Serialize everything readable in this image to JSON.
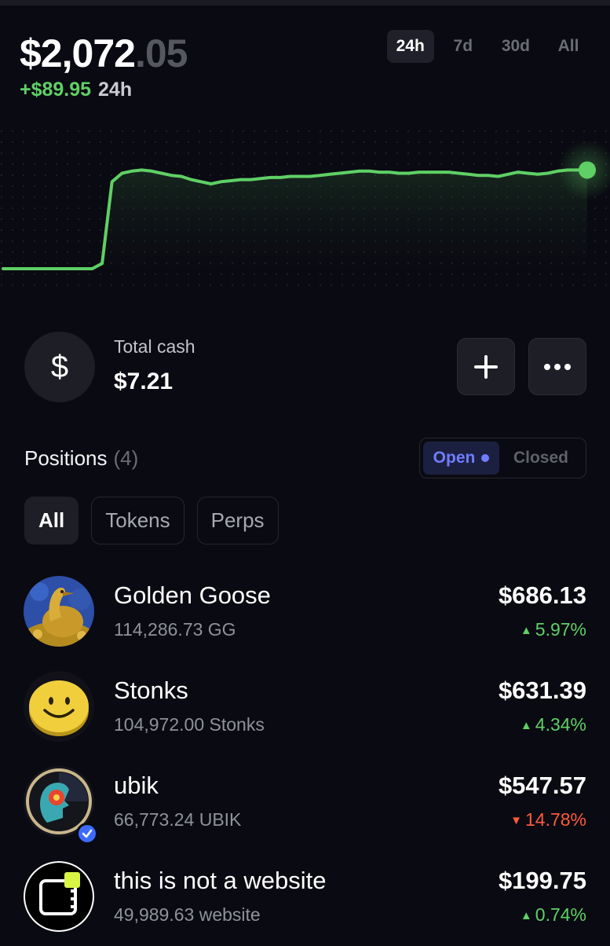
{
  "header": {
    "balance_main": "$2,072",
    "balance_cents": ".05",
    "change_value": "+$89.95",
    "change_period": "24h"
  },
  "ranges": [
    "24h",
    "7d",
    "30d",
    "All"
  ],
  "active_range": "24h",
  "chart_data": {
    "type": "line",
    "color": "#5fd065",
    "series": [
      {
        "values": [
          0,
          0,
          0,
          0,
          0,
          0,
          0,
          0,
          0,
          0,
          0.05,
          0.82,
          0.9,
          0.92,
          0.93,
          0.92,
          0.9,
          0.88,
          0.87,
          0.84,
          0.82,
          0.8,
          0.82,
          0.83,
          0.84,
          0.84,
          0.85,
          0.86,
          0.86,
          0.87,
          0.87,
          0.87,
          0.88,
          0.89,
          0.9,
          0.91,
          0.92,
          0.92,
          0.91,
          0.91,
          0.9,
          0.9,
          0.91,
          0.91,
          0.91,
          0.91,
          0.9,
          0.89,
          0.88,
          0.88,
          0.87,
          0.89,
          0.91,
          0.9,
          0.89,
          0.9,
          0.92,
          0.93,
          0.93,
          0.93
        ]
      }
    ]
  },
  "cash": {
    "icon": "dollar-icon",
    "label": "Total cash",
    "value": "$7.21"
  },
  "actions": {
    "add_icon": "plus-icon",
    "more_icon": "more-icon"
  },
  "positions": {
    "title": "Positions",
    "count": "(4)",
    "open_label": "Open",
    "closed_label": "Closed",
    "filters": [
      "All",
      "Tokens",
      "Perps"
    ],
    "items": [
      {
        "name": "Golden Goose",
        "qty": "114,286.73 GG",
        "value": "$686.13",
        "change": "5.97%",
        "direction": "up",
        "icon": "golden-goose-token-icon"
      },
      {
        "name": "Stonks",
        "qty": "104,972.00 Stonks",
        "value": "$631.39",
        "change": "4.34%",
        "direction": "up",
        "icon": "smiley-coin-icon"
      },
      {
        "name": "ubik",
        "qty": "66,773.24 UBIK",
        "value": "$547.57",
        "change": "14.78%",
        "direction": "down",
        "icon": "ubik-token-icon"
      },
      {
        "name": "this is not a website",
        "qty": "49,989.63 website",
        "value": "$199.75",
        "change": "0.74%",
        "direction": "up",
        "icon": "website-token-icon"
      }
    ]
  },
  "colors": {
    "up": "#5fd065",
    "down": "#ff5a3c",
    "accent": "#6f7dff",
    "background": "#0a0a12"
  }
}
